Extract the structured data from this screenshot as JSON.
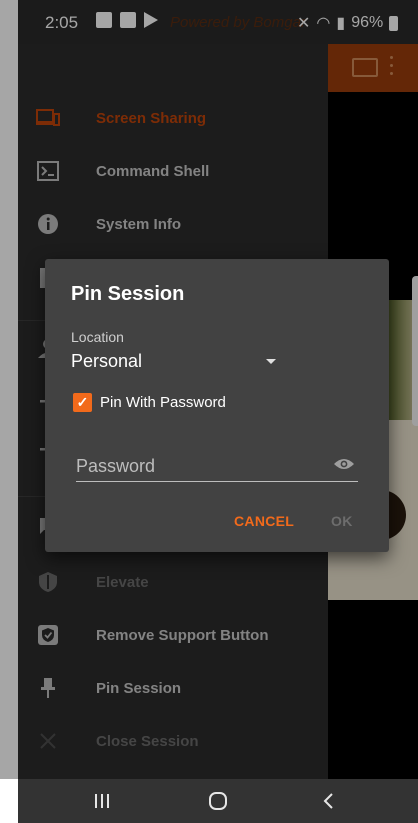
{
  "status_bar": {
    "time": "2:05",
    "battery": "96%",
    "watermark": "Powered by Bomgar"
  },
  "drawer": {
    "items": [
      {
        "label": "Screen Sharing",
        "icon": "screen-sharing-icon",
        "state": "active"
      },
      {
        "label": "Command Shell",
        "icon": "terminal-icon",
        "state": "normal"
      },
      {
        "label": "System Info",
        "icon": "info-icon",
        "state": "normal"
      },
      {
        "label": "Elevate",
        "icon": "shield-icon",
        "state": "disabled"
      },
      {
        "label": "Remove Support Button",
        "icon": "shield-check-icon",
        "state": "normal"
      },
      {
        "label": "Pin Session",
        "icon": "pin-icon",
        "state": "normal"
      },
      {
        "label": "Close Session",
        "icon": "close-icon",
        "state": "disabled"
      }
    ]
  },
  "dialog": {
    "title": "Pin Session",
    "location_label": "Location",
    "location_value": "Personal",
    "pin_with_password_label": "Pin With Password",
    "pin_with_password_checked": true,
    "password_placeholder": "Password",
    "cancel_label": "CANCEL",
    "ok_label": "OK"
  },
  "colors": {
    "accent": "#f26a1b",
    "active_item": "#c0440a",
    "drawer_bg": "#2b2b2b",
    "dialog_bg": "#424242"
  }
}
